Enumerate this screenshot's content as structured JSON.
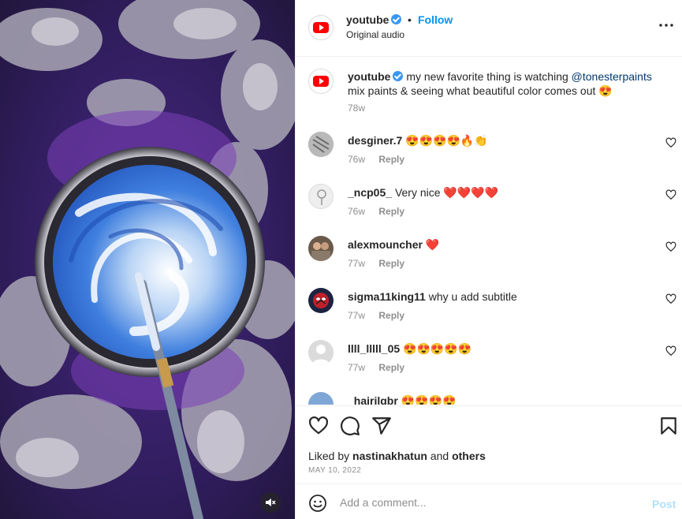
{
  "header": {
    "username": "youtube",
    "separator": "•",
    "follow_label": "Follow",
    "subtitle": "Original audio"
  },
  "caption": {
    "username": "youtube",
    "text_before": "my new favorite thing is watching",
    "mention": "@tonesterpaints",
    "text_after": "mix paints & seeing what beautiful color comes out",
    "emoji": "😍",
    "time": "78w"
  },
  "comments": [
    {
      "username": "desginer.7",
      "text": "",
      "emoji": "😍😍😍😍🔥👏",
      "time": "76w",
      "reply": "Reply",
      "avatar": "gray-pattern"
    },
    {
      "username": "_ncp05_",
      "text": "Very nice",
      "emoji": "❤️❤️❤️❤️",
      "time": "76w",
      "reply": "Reply",
      "avatar": "light-gray"
    },
    {
      "username": "alexmouncher",
      "text": "",
      "emoji": "❤️",
      "time": "77w",
      "reply": "Reply",
      "avatar": "photo-people"
    },
    {
      "username": "sigma11king11",
      "text": "why u add subtitle",
      "emoji": "",
      "time": "77w",
      "reply": "Reply",
      "avatar": "spiderman"
    },
    {
      "username": "llll_lllll_05",
      "text": "",
      "emoji": "😍😍😍😍😍",
      "time": "77w",
      "reply": "Reply",
      "avatar": "default-avatar"
    },
    {
      "username": "_hairilqbr",
      "text": "",
      "emoji": "😍😍😍😍",
      "time": "",
      "reply": "",
      "avatar": "blue-sky"
    }
  ],
  "actions": {
    "liked_prefix": "Liked by",
    "liked_user": "nastinakhatun",
    "liked_and": "and",
    "liked_others": "others",
    "date": "MAY 10, 2022"
  },
  "add_comment": {
    "placeholder": "Add a comment...",
    "post_label": "Post"
  },
  "colors": {
    "link_blue": "#0095f6",
    "verified_blue": "#3897f0",
    "post_disabled": "#b2dffc",
    "heart_red": "#e0245e",
    "youtube_red": "#ff0000"
  },
  "icons": [
    "youtube-logo-icon",
    "verified-icon",
    "more-icon",
    "heart-icon",
    "comment-icon",
    "share-icon",
    "bookmark-icon",
    "emoji-icon",
    "muted-icon"
  ]
}
